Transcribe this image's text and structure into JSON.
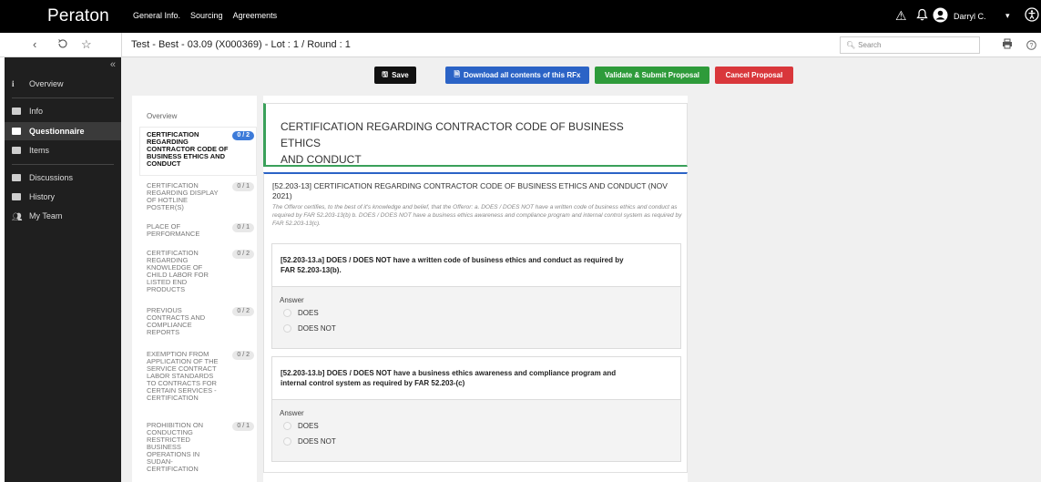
{
  "app": {
    "logo": "Peraton",
    "nav": [
      "General Info.",
      "Sourcing",
      "Agreements"
    ],
    "user_name": "Darryl C."
  },
  "subbar": {
    "breadcrumb": "Test - Best - 03.09 (X000369) - Lot : 1 / Round : 1",
    "search_placeholder": "Search"
  },
  "sidebar": {
    "items": [
      {
        "label": "Overview",
        "icon": "info-icon"
      },
      {
        "label": "Info",
        "icon": "document-icon"
      },
      {
        "label": "Questionnaire",
        "icon": "questionnaire-icon"
      },
      {
        "label": "Items",
        "icon": "items-icon"
      },
      {
        "label": "Discussions",
        "icon": "chat-icon"
      },
      {
        "label": "History",
        "icon": "history-icon"
      },
      {
        "label": "My Team",
        "icon": "team-icon"
      }
    ]
  },
  "toolbar": {
    "save": "Save",
    "download": "Download all contents of this RFx",
    "validate": "Validate & Submit Proposal",
    "cancel": "Cancel Proposal"
  },
  "questionnaire_nav": {
    "overview": "Overview",
    "sections": [
      {
        "title": "CERTIFICATION REGARDING CONTRACTOR CODE OF BUSINESS ETHICS AND CONDUCT",
        "progress": "0 / 2",
        "selected": true
      },
      {
        "title": "CERTIFICATION REGARDING DISPLAY OF HOTLINE POSTER(S)",
        "progress": "0 / 1",
        "selected": false
      },
      {
        "title": "PLACE OF PERFORMANCE",
        "progress": "0 / 1",
        "selected": false
      },
      {
        "title": "CERTIFICATION REGARDING KNOWLEDGE OF CHILD LABOR FOR LISTED END PRODUCTS",
        "progress": "0 / 2",
        "selected": false
      },
      {
        "title": "PREVIOUS CONTRACTS AND COMPLIANCE REPORTS",
        "progress": "0 / 2",
        "selected": false
      },
      {
        "title": "EXEMPTION FROM APPLICATION OF THE SERVICE CONTRACT LABOR STANDARDS TO CONTRACTS FOR CERTAIN SERVICES - CERTIFICATION",
        "progress": "0 / 2",
        "selected": false
      },
      {
        "title": "PROHIBITION ON CONDUCTING RESTRICTED BUSINESS OPERATIONS IN SUDAN-CERTIFICATION",
        "progress": "0 / 1",
        "selected": false
      }
    ]
  },
  "content": {
    "section_title_line1": "CERTIFICATION REGARDING CONTRACTOR CODE OF BUSINESS ETHICS",
    "section_title_line2": "AND CONDUCT",
    "question_heading": "[52.203-13] CERTIFICATION REGARDING CONTRACTOR CODE OF BUSINESS ETHICS AND CONDUCT (NOV 2021)",
    "question_description": "The Offeror certifies, to the best of it's knowledge and belief, that the Offeror:  a. DOES / DOES NOT have a written code of business ethics and conduct as required by FAR 52.203-13(b)  b. DOES / DOES NOT have a business ethics awareness and compliance program and internal control system as required by FAR 52.203-13(c).",
    "subquestions": [
      {
        "title": "[52.203-13.a] DOES / DOES NOT have a written code of business ethics and conduct as required by FAR 52.203-13(b).",
        "answer_label": "Answer",
        "options": [
          "DOES",
          "DOES NOT"
        ]
      },
      {
        "title": "[52.203-13.b] DOES / DOES NOT have a business ethics awareness and compliance program and internal control system as required by FAR 52.203-(c)",
        "answer_label": "Answer",
        "options": [
          "DOES",
          "DOES NOT"
        ]
      }
    ]
  }
}
